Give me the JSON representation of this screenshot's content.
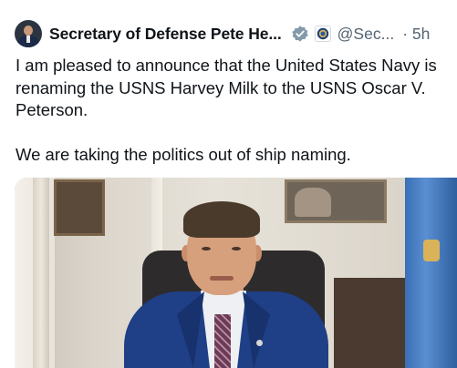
{
  "tweet": {
    "author_name": "Secretary of Defense Pete He...",
    "handle": "@Sec...",
    "time": "· 5h",
    "paragraphs": [
      "I am pleased to announce that the United States Navy is renaming the USNS Harvey Milk to the USNS Oscar V. Peterson.",
      "We are taking the politics out of ship naming."
    ]
  },
  "icons": {
    "avatar": "author-avatar",
    "verified": "gray-verified-checkmark-icon",
    "org": "department-of-defense-seal-icon"
  },
  "colors": {
    "text_primary": "#0f1419",
    "text_secondary": "#536471",
    "verified_badge": "#829aab"
  }
}
